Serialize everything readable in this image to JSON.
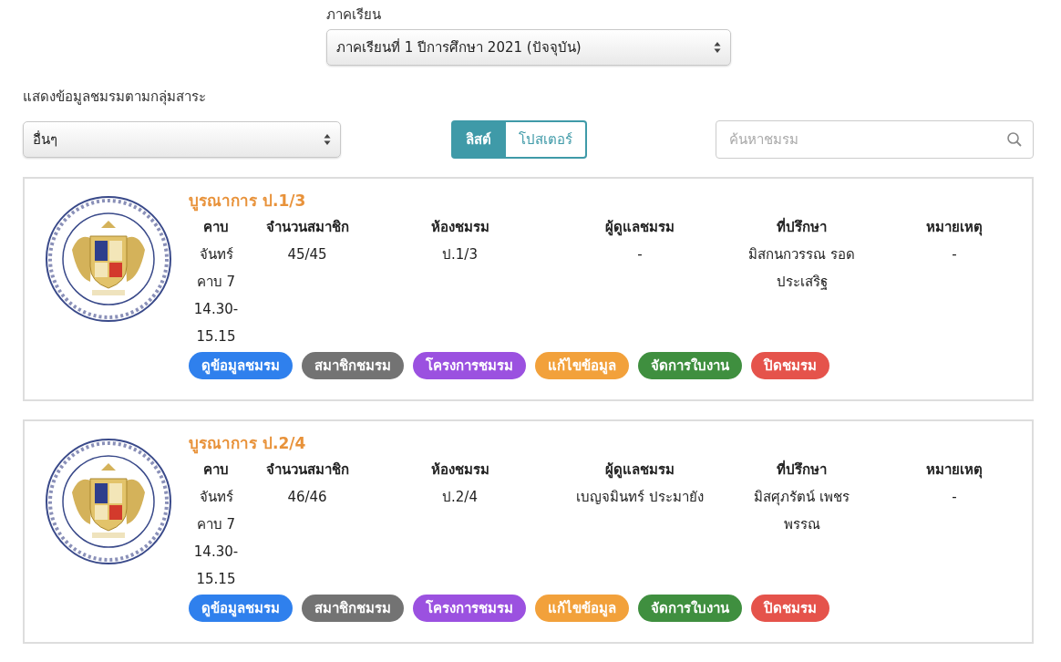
{
  "semester": {
    "label": "ภาคเรียน",
    "value": "ภาคเรียนที่ 1 ปีการศึกษา 2021 (ปัจจุบัน)"
  },
  "filter": {
    "label": "แสดงข้อมูลชมรมตามกลุ่มสาระ",
    "value": "อื่นๆ"
  },
  "view_toggle": [
    {
      "label": "ลิสต์",
      "selected": true
    },
    {
      "label": "โปสเตอร์",
      "selected": false
    }
  ],
  "search": {
    "placeholder": "ค้นหาชมรม"
  },
  "clubs": [
    {
      "name": "บูรณาการ ป.1/3",
      "columns": [
        "คาบ",
        "จำนวนสมาชิก",
        "ห้องชมรม",
        "ผู้ดูแลชมรม",
        "ที่ปรึกษา",
        "หมายเหตุ"
      ],
      "cells": [
        [
          "จันทร์",
          "คาบ 7",
          "14.30-",
          "15.15"
        ],
        [
          "45/45"
        ],
        [
          "ป.1/3"
        ],
        [
          "-"
        ],
        [
          "มิสกนกวรรณ รอด",
          "ประเสริฐ"
        ],
        [
          "-"
        ]
      ],
      "buttons": [
        {
          "label": "ดูข้อมูลชมรม",
          "color": "#2f80ed"
        },
        {
          "label": "สมาชิกชมรม",
          "color": "#737373"
        },
        {
          "label": "โครงการชมรม",
          "color": "#9b51e0"
        },
        {
          "label": "แก้ไขข้อมูล",
          "color": "#f2a13b"
        },
        {
          "label": "จัดการใบงาน",
          "color": "#3f8f3f"
        },
        {
          "label": "ปิดชมรม",
          "color": "#e5534b"
        }
      ]
    },
    {
      "name": "บูรณาการ ป.2/4",
      "columns": [
        "คาบ",
        "จำนวนสมาชิก",
        "ห้องชมรม",
        "ผู้ดูแลชมรม",
        "ที่ปรึกษา",
        "หมายเหตุ"
      ],
      "cells": [
        [
          "จันทร์",
          "คาบ 7",
          "14.30-",
          "15.15"
        ],
        [
          "46/46"
        ],
        [
          "ป.2/4"
        ],
        [
          "เบญจมินทร์ ประมายัง"
        ],
        [
          "มิสศุภรัตน์ เพชร",
          "พรรณ"
        ],
        [
          "-"
        ]
      ],
      "buttons": [
        {
          "label": "ดูข้อมูลชมรม",
          "color": "#2f80ed"
        },
        {
          "label": "สมาชิกชมรม",
          "color": "#737373"
        },
        {
          "label": "โครงการชมรม",
          "color": "#9b51e0"
        },
        {
          "label": "แก้ไขข้อมูล",
          "color": "#f2a13b"
        },
        {
          "label": "จัดการใบงาน",
          "color": "#3f8f3f"
        },
        {
          "label": "ปิดชมรม",
          "color": "#e5534b"
        }
      ]
    }
  ]
}
